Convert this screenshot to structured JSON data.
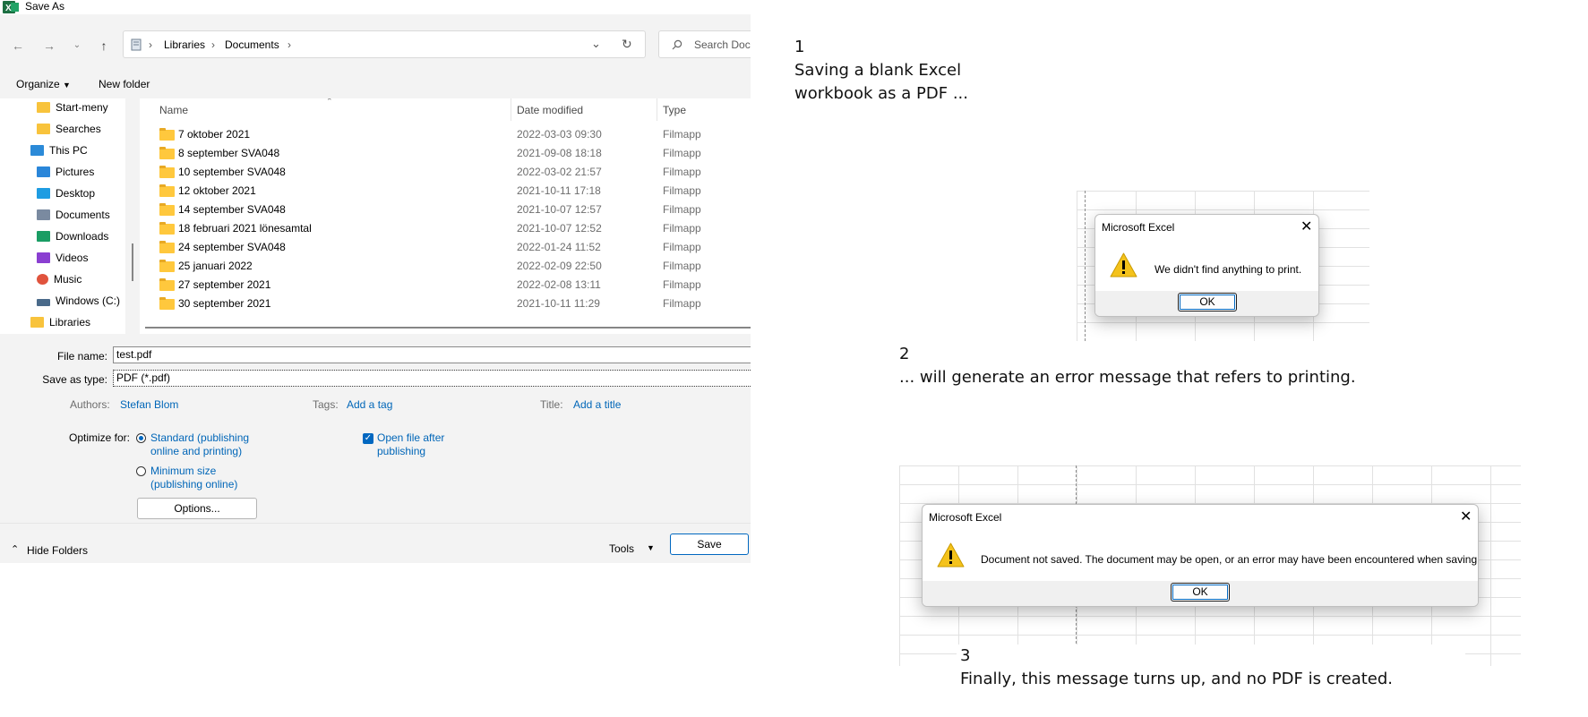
{
  "dialog": {
    "title": "Save As",
    "breadcrumb": [
      "Libraries",
      "Documents"
    ],
    "search_placeholder": "Search Docu",
    "organize_label": "Organize",
    "new_folder_label": "New folder",
    "nav_items": [
      {
        "label": "Start-meny",
        "icon": "folder-icon",
        "color": "#f8c33c"
      },
      {
        "label": "Searches",
        "icon": "folder-icon",
        "color": "#f8c33c"
      },
      {
        "label": "This PC",
        "icon": "pc-icon",
        "color": "#2b8ad8"
      },
      {
        "label": "Pictures",
        "icon": "pictures-icon",
        "color": "#2a86d9"
      },
      {
        "label": "Desktop",
        "icon": "desktop-icon",
        "color": "#1e9ce2"
      },
      {
        "label": "Documents",
        "icon": "documents-icon",
        "color": "#7a8aa0"
      },
      {
        "label": "Downloads",
        "icon": "download-icon",
        "color": "#1a9d64"
      },
      {
        "label": "Videos",
        "icon": "videos-icon",
        "color": "#8a3fd1"
      },
      {
        "label": "Music",
        "icon": "music-icon",
        "color": "#e0533d"
      },
      {
        "label": "Windows (C:)",
        "icon": "drive-icon",
        "color": "#4a6a8a"
      },
      {
        "label": "Libraries",
        "icon": "folder-icon",
        "color": "#f8c33c"
      }
    ],
    "columns": {
      "name": "Name",
      "date": "Date modified",
      "type": "Type"
    },
    "files": [
      {
        "name": "7 oktober 2021",
        "date": "2022-03-03 09:30",
        "type": "Filmapp"
      },
      {
        "name": "8 september SVA048",
        "date": "2021-09-08 18:18",
        "type": "Filmapp"
      },
      {
        "name": "10 september SVA048",
        "date": "2022-03-02 21:57",
        "type": "Filmapp"
      },
      {
        "name": "12 oktober 2021",
        "date": "2021-10-11 17:18",
        "type": "Filmapp"
      },
      {
        "name": "14 september SVA048",
        "date": "2021-10-07 12:57",
        "type": "Filmapp"
      },
      {
        "name": "18 februari 2021 lönesamtal",
        "date": "2021-10-07 12:52",
        "type": "Filmapp"
      },
      {
        "name": "24 september SVA048",
        "date": "2022-01-24 11:52",
        "type": "Filmapp"
      },
      {
        "name": "25 januari 2022",
        "date": "2022-02-09 22:50",
        "type": "Filmapp"
      },
      {
        "name": "27 september 2021",
        "date": "2022-02-08 13:11",
        "type": "Filmapp"
      },
      {
        "name": "30 september 2021",
        "date": "2021-10-11 11:29",
        "type": "Filmapp"
      }
    ],
    "file_name_label": "File name:",
    "file_name_value": "test.pdf",
    "save_type_label": "Save as type:",
    "save_type_value": "PDF (*.pdf)",
    "authors_label": "Authors:",
    "authors_value": "Stefan Blom",
    "tags_label": "Tags:",
    "tags_value": "Add a tag",
    "title_label": "Title:",
    "title_value": "Add a title",
    "optimize_label": "Optimize for:",
    "opt_standard_line1": "Standard (publishing",
    "opt_standard_line2": "online and printing)",
    "opt_min_line1": "Minimum size",
    "opt_min_line2": "(publishing online)",
    "open_after_line1": "Open file after",
    "open_after_line2": "publishing",
    "options_label": "Options...",
    "hide_folders_label": "Hide Folders",
    "tools_label": "Tools",
    "save_label": "Save"
  },
  "captions": {
    "c1_num": "1",
    "c1_line1": "Saving a blank Excel",
    "c1_line2": "workbook as a PDF ...",
    "c2_num": "2",
    "c2_text": "... will generate an error message that refers to printing.",
    "c3_num": "3",
    "c3_text": "Finally, this message turns up, and no PDF is created."
  },
  "msg1": {
    "title": "Microsoft Excel",
    "text": "We didn't find anything to print.",
    "ok": "OK"
  },
  "msg2": {
    "title": "Microsoft Excel",
    "text": "Document not saved. The document may be open, or an error may have been encountered when saving.",
    "ok": "OK"
  },
  "colors": {
    "accent": "#0067c0",
    "link": "#0066b8",
    "warning": "#f4c21b"
  }
}
